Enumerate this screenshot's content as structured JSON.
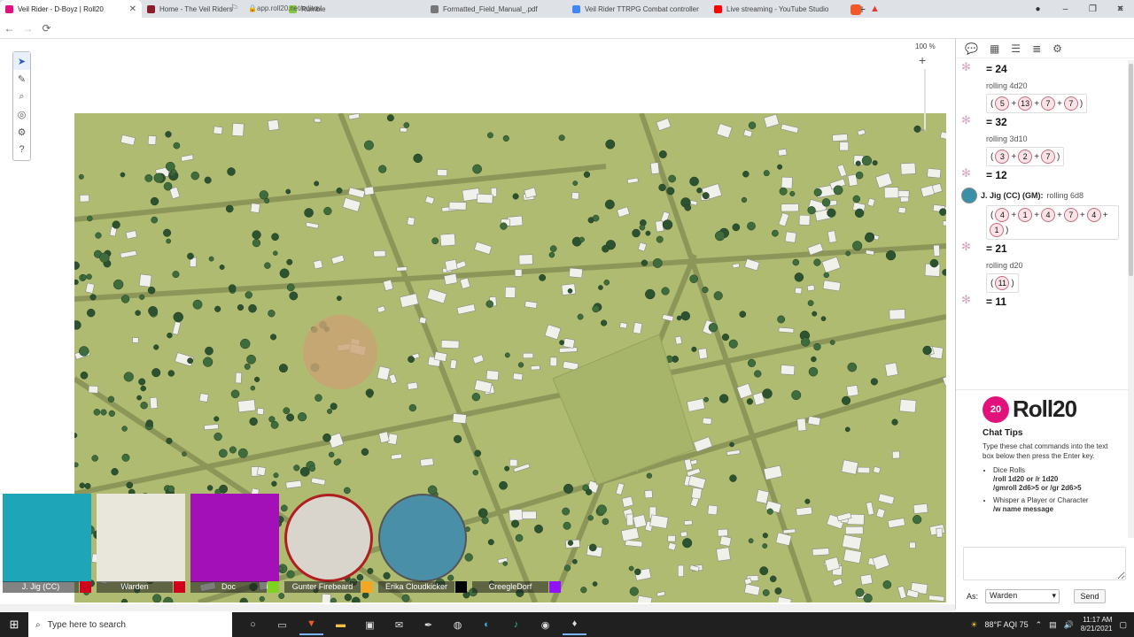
{
  "browser": {
    "tabs": [
      {
        "label": "Veil Rider - D-Boyz | Roll20",
        "color": "#e1127c",
        "active": true
      },
      {
        "label": "Home - The Veil Riders",
        "color": "#8a1c2b",
        "active": false
      },
      {
        "label": "Rumble",
        "color": "#85c742",
        "active": false
      },
      {
        "label": "Formatted_Field_Manual_.pdf",
        "color": "#777777",
        "active": false
      },
      {
        "label": "Veil Rider TTRPG Combat controller",
        "color": "#4285f4",
        "active": false
      },
      {
        "label": "Live streaming - YouTube Studio",
        "color": "#ff0000",
        "active": false
      }
    ],
    "new_tab": "+",
    "url": "app.roll20.net/editor/"
  },
  "map": {
    "zoom_label": "100 %"
  },
  "players": [
    {
      "name": "J. Jig (CC)",
      "color": "#d0021b",
      "avatar_bg": "#1fa5b8"
    },
    {
      "name": "Warden",
      "color": "#d0021b",
      "avatar_bg": "#e9e6dc"
    },
    {
      "name": "Doc",
      "color": "#7ed321",
      "avatar_bg": "#a310b8"
    },
    {
      "name": "Gunter Firebeard",
      "color": "#f5a623",
      "avatar_bg": "#d9d4cc"
    },
    {
      "name": "Erika Cloudkicker",
      "color": "#000000",
      "avatar_bg": "#4a8fa8"
    },
    {
      "name": "CreegleDorf",
      "color": "#9013fe",
      "avatar_bg": "#ffffff"
    }
  ],
  "chat": {
    "messages": [
      {
        "total": "= 24"
      },
      {
        "formula": "rolling 4d20",
        "dice": [
          "5",
          "13",
          "7",
          "7"
        ],
        "total": "= 32"
      },
      {
        "formula": "rolling 3d10",
        "dice": [
          "3",
          "2",
          "7"
        ],
        "total": "= 12"
      },
      {
        "speaker": "J. Jig (CC) (GM):",
        "formula": "rolling 6d8",
        "dice": [
          "4",
          "1",
          "4",
          "7",
          "4",
          "1"
        ],
        "total": "= 21"
      },
      {
        "formula": "rolling d20",
        "dice": [
          "11"
        ],
        "total": "= 11"
      }
    ],
    "logo_text": "Roll20",
    "tips_title": "Chat Tips",
    "tips_intro": "Type these chat commands into the text box below then press the Enter key.",
    "tips": [
      {
        "label": "Dice Rolls",
        "lines": [
          "/roll 1d20 or /r 1d20",
          "/gmroll 2d6>5 or /gr 2d6>5"
        ]
      },
      {
        "label": "Whisper a Player or Character",
        "lines": [
          "/w name message"
        ]
      }
    ],
    "as_label": "As:",
    "as_value": "Warden",
    "send_label": "Send"
  },
  "taskbar": {
    "search_placeholder": "Type here to search",
    "weather": "88°F AQI 75",
    "time": "11:17 AM",
    "date": "8/21/2021"
  }
}
